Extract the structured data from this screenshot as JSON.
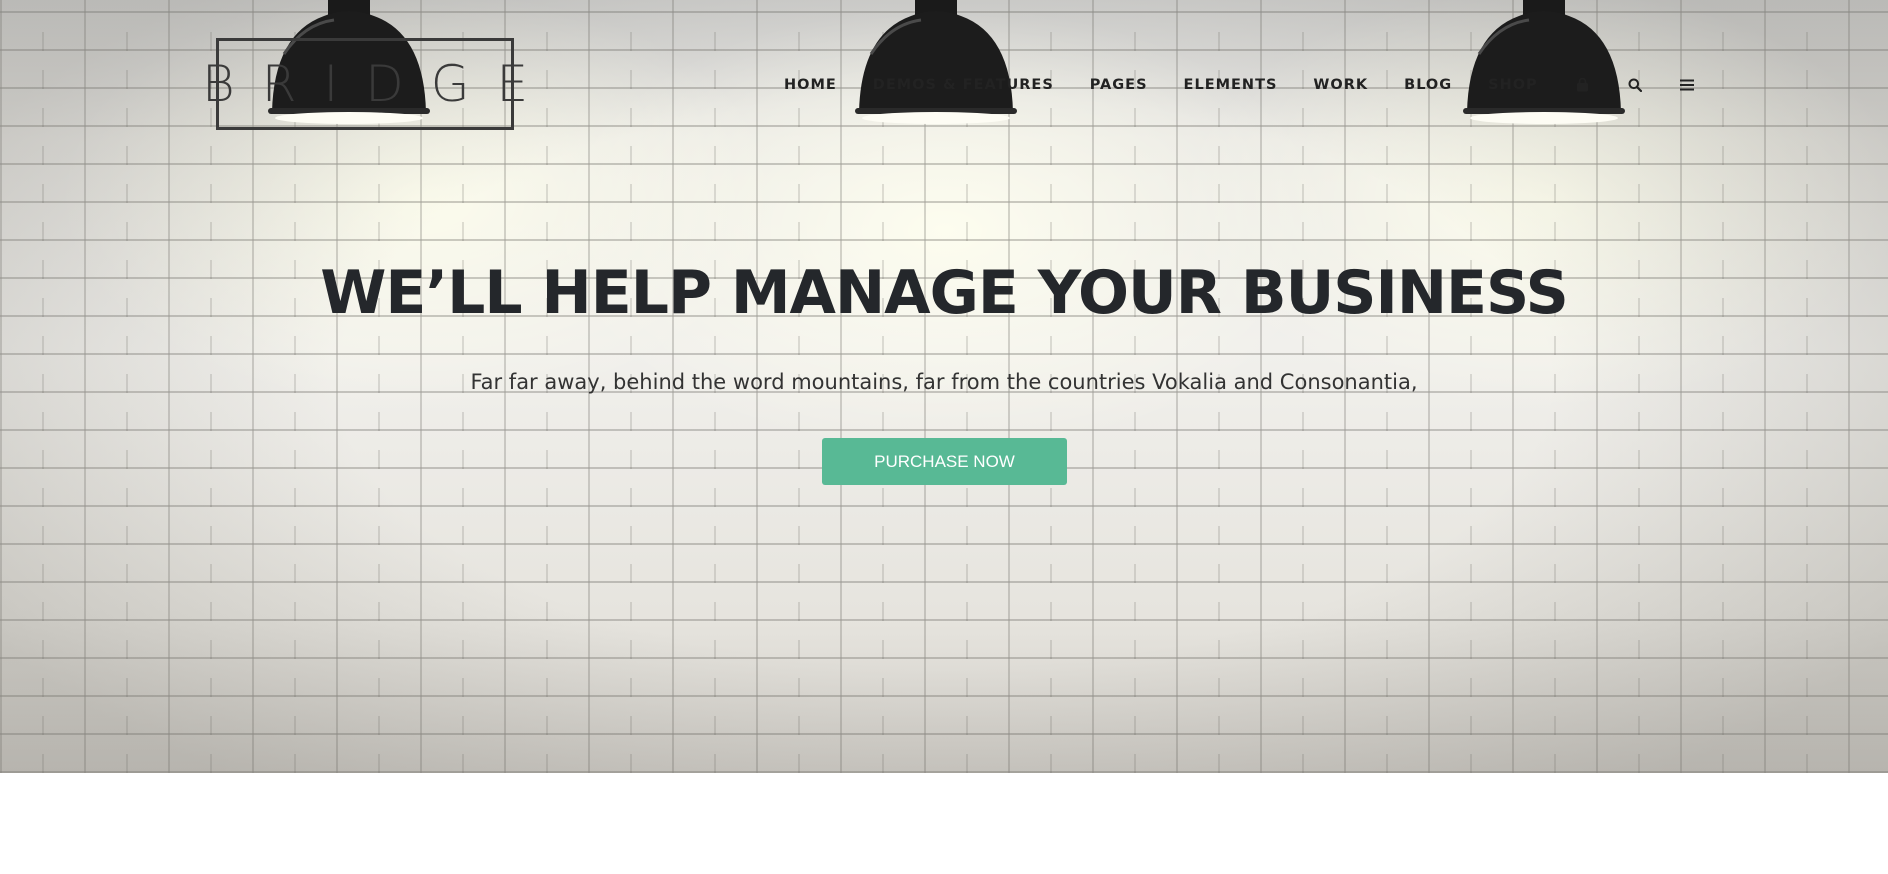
{
  "brand": {
    "logo_text": "BRIDGE"
  },
  "nav": {
    "items": [
      {
        "label": "HOME"
      },
      {
        "label": "DEMOS & FEATURES"
      },
      {
        "label": "PAGES"
      },
      {
        "label": "ELEMENTS"
      },
      {
        "label": "WORK"
      },
      {
        "label": "BLOG"
      },
      {
        "label": "SHOP"
      }
    ],
    "icons": [
      "shopping-bag-icon",
      "search-icon",
      "menu-icon"
    ]
  },
  "hero": {
    "headline": "WE’LL HELP MANAGE YOUR BUSINESS",
    "subtext": "Far far away, behind the word mountains, far from the countries Vokalia and Consonantia,",
    "cta_label": "PURCHASE NOW"
  },
  "colors": {
    "accent": "#58b995",
    "text_dark": "#24272b",
    "lamp": "#1c1c1c"
  }
}
